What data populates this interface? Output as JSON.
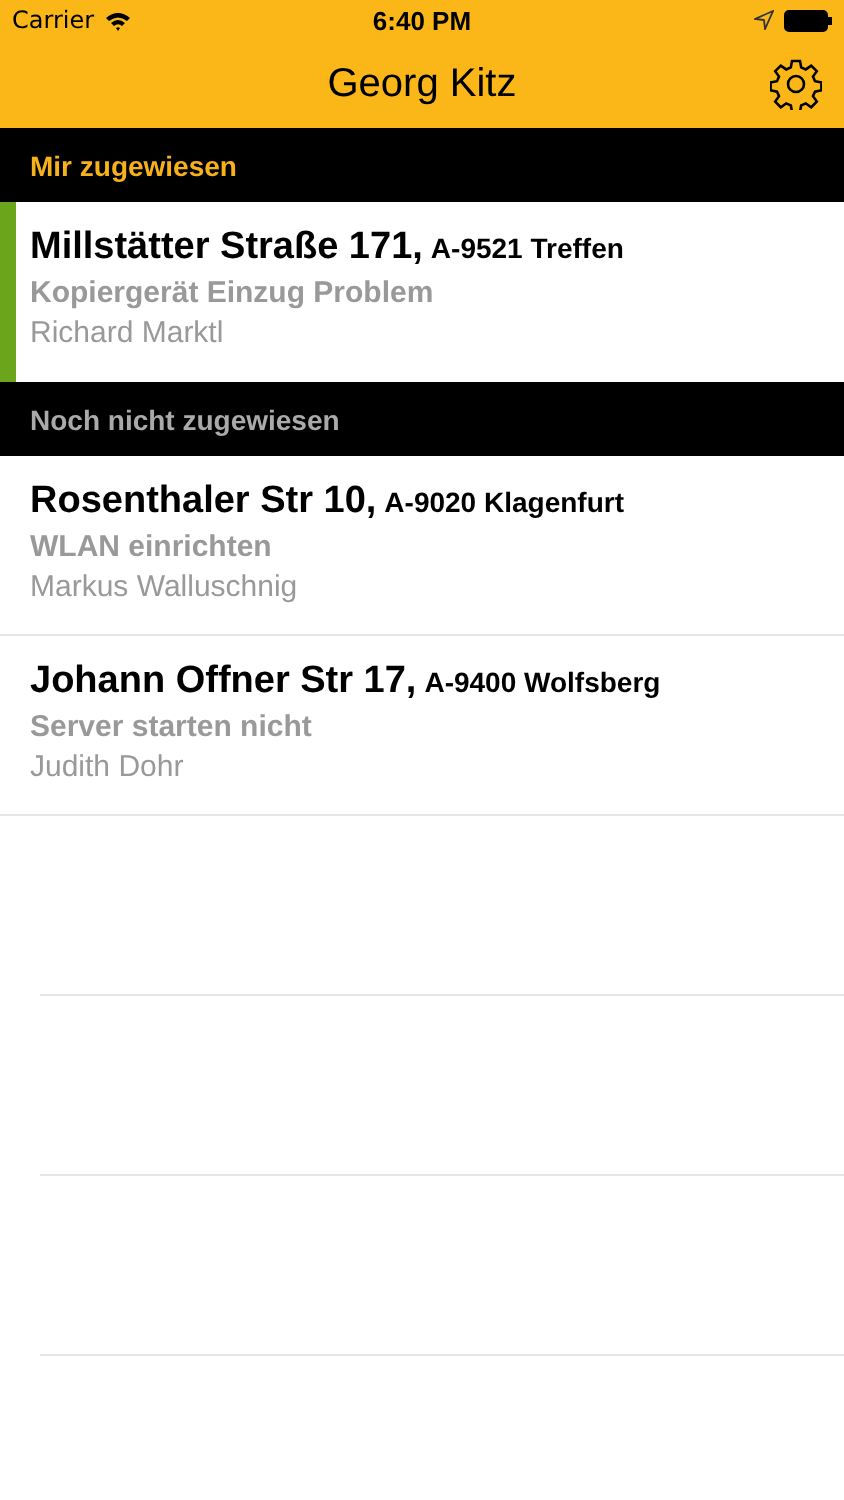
{
  "status_bar": {
    "carrier": "Carrier",
    "time": "6:40 PM"
  },
  "nav": {
    "title": "Georg Kitz"
  },
  "sections": [
    {
      "title": "Mir zugewiesen",
      "color": "#f7b21b",
      "rows": [
        {
          "street": "Millstätter Straße 171,",
          "city": "A-9521 Treffen",
          "subject": "Kopiergerät Einzug Problem",
          "person": "Richard Marktl",
          "marked": true
        }
      ]
    },
    {
      "title": "Noch nicht zugewiesen",
      "color": "#aaaaaa",
      "rows": [
        {
          "street": "Rosenthaler Str 10,",
          "city": "A-9020 Klagenfurt",
          "subject": "WLAN einrichten",
          "person": "Markus Walluschnig",
          "marked": false
        },
        {
          "street": "Johann Offner Str 17,",
          "city": "A-9400 Wolfsberg",
          "subject": "Server starten nicht",
          "person": "Judith Dohr",
          "marked": false
        }
      ]
    }
  ]
}
